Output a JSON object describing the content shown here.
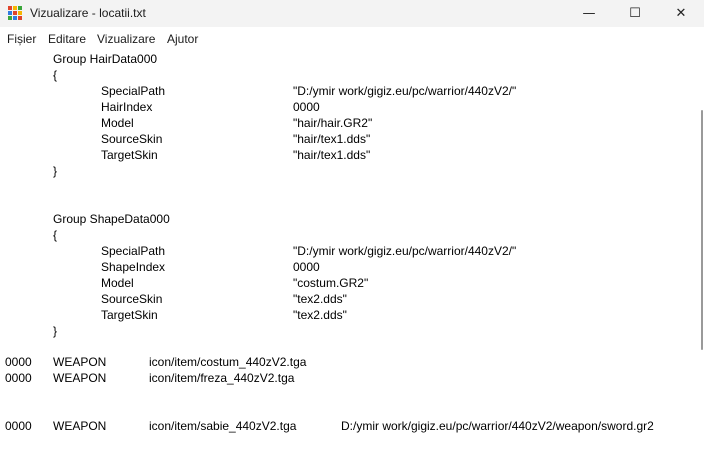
{
  "window": {
    "title": "Vizualizare - locatii.txt",
    "controls": {
      "minimize": "—",
      "maximize": "☐",
      "close": "✕"
    }
  },
  "menu": {
    "items": [
      "Fișier",
      "Editare",
      "Vizualizare",
      "Ajutor"
    ]
  },
  "editor": {
    "hair_group": {
      "header": "Group HairData000",
      "open": "{",
      "close": "}",
      "rows": [
        {
          "key": "SpecialPath",
          "value": "\"D:/ymir work/gigiz.eu/pc/warrior/440zV2/\""
        },
        {
          "key": "HairIndex",
          "value": "0000"
        },
        {
          "key": "Model",
          "value": "\"hair/hair.GR2\""
        },
        {
          "key": "SourceSkin",
          "value": "\"hair/tex1.dds\""
        },
        {
          "key": "TargetSkin",
          "value": "\"hair/tex1.dds\""
        }
      ]
    },
    "shape_group": {
      "header": "Group ShapeData000",
      "open": "{",
      "close": "}",
      "rows": [
        {
          "key": "SpecialPath",
          "value": "\"D:/ymir work/gigiz.eu/pc/warrior/440zV2/\""
        },
        {
          "key": "ShapeIndex",
          "value": "0000"
        },
        {
          "key": "Model",
          "value": "\"costum.GR2\""
        },
        {
          "key": "SourceSkin",
          "value": "\"tex2.dds\""
        },
        {
          "key": "TargetSkin",
          "value": "\"tex2.dds\""
        }
      ]
    },
    "weapon_lines": [
      {
        "index": "0000",
        "type": "WEAPON",
        "icon": "icon/item/costum_440zV2.tga",
        "path": ""
      },
      {
        "index": "0000",
        "type": "WEAPON",
        "icon": "icon/item/freza_440zV2.tga",
        "path": ""
      },
      {
        "index": "0000",
        "type": "WEAPON",
        "icon": "icon/item/sabie_440zV2.tga",
        "path": "D:/ymir work/gigiz.eu/pc/warrior/440zV2/weapon/sword.gr2"
      }
    ]
  }
}
